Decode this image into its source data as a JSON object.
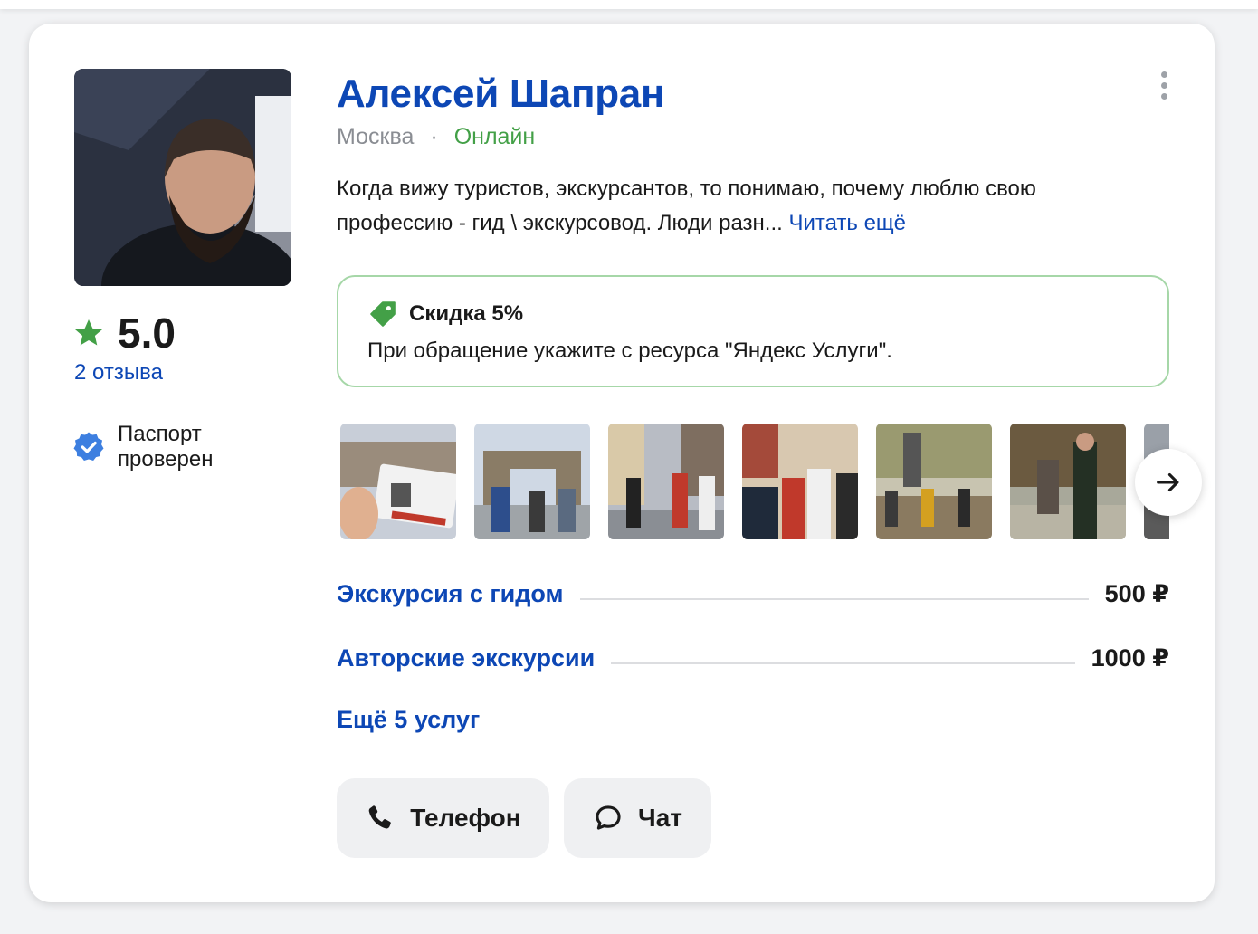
{
  "profile": {
    "name": "Алексей Шапран",
    "city": "Москва",
    "separator": "·",
    "status": "Онлайн",
    "rating": "5.0",
    "reviews": "2 отзыва",
    "verified": "Паспорт проверен",
    "description": "Когда вижу туристов, экскурсантов, то понимаю, почему люблю свою профессию - гид \\ экскурсовод. Люди разн...",
    "read_more": "Читать ещё"
  },
  "promo": {
    "title": "Скидка 5%",
    "text": "При обращение укажите с ресурса \"Яндекс Услуги\"."
  },
  "services": [
    {
      "name": "Экскурсия с гидом",
      "price": "500 ₽"
    },
    {
      "name": "Авторские экскурсии",
      "price": "1000 ₽"
    }
  ],
  "more_services": "Ещё 5 услуг",
  "actions": {
    "phone": "Телефон",
    "chat": "Чат"
  },
  "colors": {
    "link": "#0d47b5",
    "online": "#43a047",
    "star": "#43a047",
    "promo_border": "#a6d7a8",
    "badge": "#3d7fe0"
  }
}
